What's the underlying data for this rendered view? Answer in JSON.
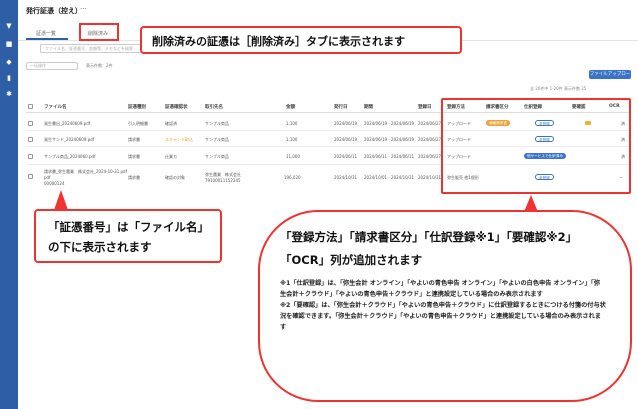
{
  "sidebar": {
    "icons": [
      "funnel-icon",
      "folder-icon",
      "tag-icon",
      "chart-icon",
      "gear-icon"
    ]
  },
  "header": {
    "title": "発行証憑（控え）",
    "more": "···"
  },
  "tabs": [
    {
      "label": "証憑一覧"
    },
    {
      "label": "削除済み"
    }
  ],
  "search": {
    "placeholder": "ファイル名、証憑番号、金額等、メモなどを検索"
  },
  "toolbar": {
    "filter_placeholder": "一括操作",
    "count_text": "表示件数：2件",
    "add_label": "ファイルアップロード",
    "pager_text": "全 20件中 1-20件  表示件数  25"
  },
  "table": {
    "headers": [
      "ファイル名",
      "証憑種別",
      "証憑確認状",
      "取引先名",
      "金額",
      "発行日",
      "期間",
      "登録日",
      "登録方法",
      "請求書区分",
      "仕訳登録",
      "要確認",
      "OCR"
    ],
    "rows": [
      {
        "file": "発生書出_20240609.pdf",
        "type": "引入明細書",
        "status": "確認済",
        "partner": "サンプル商品",
        "amount": "1,100",
        "issued": "2024/06/19",
        "period": "2024/06/19 - 2024/06/19",
        "registered": "2024/06/27",
        "method": "アップロード",
        "invoice_badge": "適格請求書",
        "journal_badge": "未登録",
        "check": true,
        "ocr": "済"
      },
      {
        "file": "発生サンド_20240609.pdf",
        "type": "請求書",
        "status": "スキャンデ取込",
        "partner": "サンプル商品",
        "amount": "1,100",
        "issued": "2024/06/19",
        "period": "2024/06/19 - 2024/06/19",
        "registered": "2024/06/27",
        "method": "アップロード",
        "invoice_badge": "",
        "journal_badge": "未登録",
        "check": false,
        "ocr": "済"
      },
      {
        "file": "サンプル商品_2024060.pdf",
        "type": "請求書",
        "status": "仕業カ",
        "partner": "サンプル商品",
        "amount": "11,000",
        "issued": "2024/06/11",
        "period": "2024/06/11 - 2024/06/11",
        "registered": "2024/06/27",
        "method": "アップロード",
        "invoice_badge": "",
        "journal_badge": "他サービスで仕訳済み",
        "check": false,
        "ocr": "済"
      },
      {
        "file": "請求書_弥生農業　株式会社_2024-10-31.pdf",
        "file_sub": "pdf",
        "voucher_no": "00000124",
        "type": "請求書",
        "status": "確認の対象",
        "partner": "弥生農業　株式会社",
        "partner_sub": "T9100011152345",
        "amount": "196,020",
        "issued": "2024/10/31",
        "period": "2024/10/01 - 2024/10/31",
        "registered": "2024/10/31",
        "method": "弥生販売 他1個形",
        "invoice_badge": "",
        "journal_badge": "未登録",
        "check": false,
        "ocr": "—"
      }
    ]
  },
  "callouts": {
    "top": "削除済みの証憑は［削除済み］タブに表示されます",
    "left": "「証憑番号」は「ファイル名」の下に表示されます",
    "big_head": "「登録方法」「請求書区分」「仕訳登録※1」「要確認※2」「OCR」列が追加されます",
    "note1": "※1「仕訳登録」は、「弥生会計 オンライン」「やよいの青色申告 オンライン」「やよいの白色申告 オンライン」「弥生会計＋クラウド」「やよいの青色申告＋クラウド」と連携設定している場合のみ表示されます",
    "note2": "※2「要確認」は、「弥生会計＋クラウド」「やよいの青色申告＋クラウド」に仕訳登録するときにつける付箋の付与状況を確認できます。「弥生会計＋クラウド」「やよいの青色申告＋クラウド」と連携設定している場合のみ表示されます"
  },
  "colors": {
    "sidebar": "#2e5fa6",
    "accent_red": "#e33333",
    "badge_orange": "#e8a33a",
    "link_blue": "#3b73c8"
  }
}
